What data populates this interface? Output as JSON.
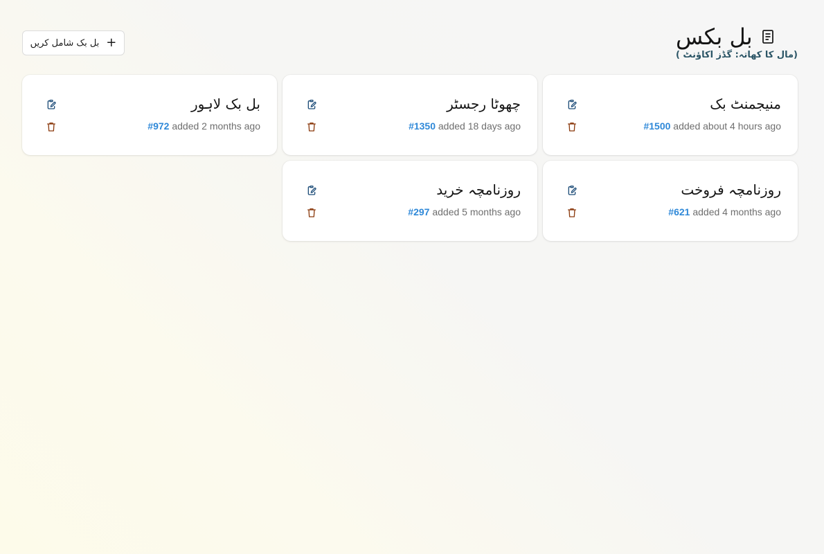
{
  "header": {
    "title": "بل بکس",
    "subtitle": "(مال کا کھاتہ: گڈز اکاؤنٹ )"
  },
  "toolbar": {
    "add_label": "بل بک شامل کریں",
    "add_icon": "plus-icon"
  },
  "colors": {
    "accent": "#2e88d8",
    "edit_icon": "#1f4e79",
    "delete_icon": "#8b3a0e",
    "subtitle": "#2b5566"
  },
  "cards": [
    {
      "title": "منیجمنٹ بک",
      "id": "#1500",
      "added": "added about 4 hours ago"
    },
    {
      "title": "چھوٹا رجسٹر",
      "id": "#1350",
      "added": "added 18 days ago"
    },
    {
      "title": "بل بک لاہور",
      "id": "#972",
      "added": "added 2 months ago"
    },
    {
      "title": "روزنامچہ فروخت",
      "id": "#621",
      "added": "added 4 months ago"
    },
    {
      "title": "روزنامچہ خرید",
      "id": "#297",
      "added": "added 5 months ago"
    }
  ]
}
